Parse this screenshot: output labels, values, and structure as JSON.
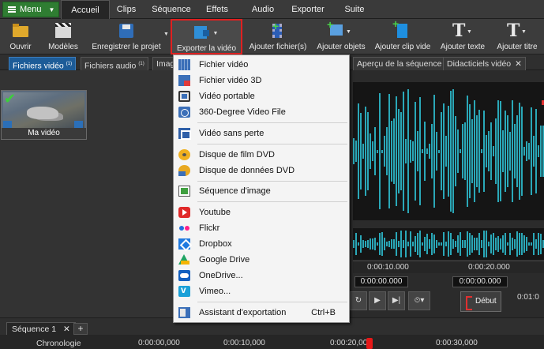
{
  "menubar": {
    "menu_button": "Menu",
    "tabs": [
      "Accueil",
      "Clips",
      "Séquence",
      "Effets",
      "Audio",
      "Exporter",
      "Suite"
    ]
  },
  "ribbon": {
    "open": "Ouvrir",
    "templates": "Modèles",
    "save_project": "Enregistrer le projet",
    "export_video": "Exporter la vidéo",
    "add_files": "Ajouter fichier(s)",
    "add_objects": "Ajouter objets",
    "add_blank_clip": "Ajouter clip vide",
    "add_text": "Ajouter texte",
    "add_title": "Ajouter titre"
  },
  "panel_tabs": {
    "video_files": "Fichiers vidéo",
    "video_files_count": "(1)",
    "audio_files": "Fichiers audio",
    "audio_files_count": "(1)",
    "images_partial": "Imag",
    "sequence_preview": "Aperçu de la séquence",
    "tutorials": "Didacticiels vidéo"
  },
  "media": {
    "clip_name": "Ma vidéo"
  },
  "export_menu": {
    "items": [
      {
        "label": "Fichier vidéo",
        "icon": "film-icon"
      },
      {
        "label": "Fichier vidéo 3D",
        "icon": "3d-film-icon"
      },
      {
        "label": "Vidéo portable",
        "icon": "phone-icon"
      },
      {
        "label": "360-Degree Video File",
        "icon": "360-video-icon"
      },
      {
        "label": "Vidéo sans perte",
        "icon": "lossless-icon"
      },
      {
        "label": "Disque de film DVD",
        "icon": "dvd-icon"
      },
      {
        "label": "Disque de données DVD",
        "icon": "data-dvd-icon"
      },
      {
        "label": "Séquence d'image",
        "icon": "image-sequence-icon"
      },
      {
        "label": "Youtube",
        "icon": "youtube-icon"
      },
      {
        "label": "Flickr",
        "icon": "flickr-icon"
      },
      {
        "label": "Dropbox",
        "icon": "dropbox-icon"
      },
      {
        "label": "Google Drive",
        "icon": "google-drive-icon"
      },
      {
        "label": "OneDrive...",
        "icon": "onedrive-icon"
      },
      {
        "label": "Vimeo...",
        "icon": "vimeo-icon"
      },
      {
        "label": "Assistant d'exportation",
        "icon": "export-wizard-icon",
        "shortcut": "Ctrl+B"
      }
    ]
  },
  "preview": {
    "ruler_a": "0:00:10.000",
    "ruler_b": "0:00:20.000",
    "time_left": "0:00:00.000",
    "time_right": "0:00:00.000",
    "time_partial": "0:01:0",
    "start_button": "Début"
  },
  "sequence": {
    "tab": "Séquence 1",
    "timeline_label": "Chronologie",
    "t0": "0:00:00,000",
    "t10": "0:00:10,000",
    "t20": "0:00:20,000",
    "t30": "0:00:30,000"
  },
  "colors": {
    "menu_green": "#2f7d32",
    "active_tab_blue": "#1d5c98",
    "waveform": "#2aa8b8",
    "highlight_red": "#e02020"
  }
}
